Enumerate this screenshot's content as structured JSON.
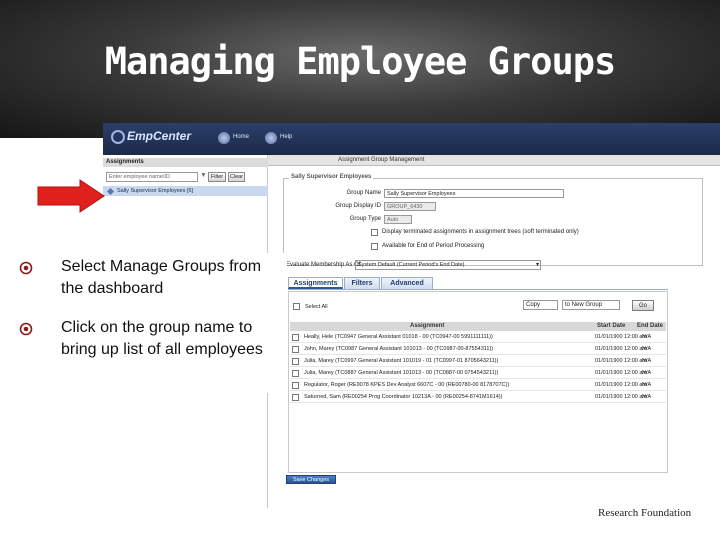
{
  "slide": {
    "title": "Managing Employee Groups",
    "bullets": [
      "Select Manage Groups from the dashboard",
      "Click on the group name  to bring up list of all employees"
    ],
    "footer_logo": "Research Foundation"
  },
  "app": {
    "brand": "EmpCenter",
    "nav": [
      "Home",
      "Help"
    ],
    "page_header": "Assignment Group Management",
    "left_pane": {
      "header": "Assignments",
      "search_placeholder": "Enter employee name/ID",
      "filter_button": "Filter",
      "clear_button": "Clear",
      "group_item": "Sally Supervisor Employees [6]"
    },
    "details": {
      "legend": "Sally Supervisor Employees",
      "group_name_label": "Group Name",
      "group_name_value": "Sally Supervisor Employees",
      "display_id_label": "Group Display ID",
      "display_id_value": "GROUP_6430",
      "group_type_label": "Group Type",
      "group_type_value": "Auto",
      "option1": "Display terminated assignments in assignment trees (soft terminated only)",
      "option2": "Available for End of Period Processing",
      "evaluate_label": "Evaluate Membership As Of",
      "evaluate_value": "System Default (Current Period's End Date)"
    },
    "tabs": [
      "Assignments",
      "Filters",
      "Advanced"
    ],
    "grid": {
      "select_all": "Select All",
      "copy_option": "Copy",
      "target_option": "to New Group",
      "go_button": "Go",
      "columns": [
        "Assignment",
        "Start Date",
        "End Date"
      ],
      "rows": [
        {
          "assignment": "Heally, Hele (TC0947 General Assistant 01018 - 00 (TC0947-00 5991111111))",
          "start": "01/01/1900 12:00 am",
          "end": "N/A"
        },
        {
          "assignment": "John, Marey (TC0987 General Assistant 101013 - 00 (TC0987-00-87554311))",
          "start": "01/01/1900 12:00 am",
          "end": "N/A"
        },
        {
          "assignment": "Julia, Marey (TC0997 General Assistant 101019 - 01 (TC0997-01 8705643211))",
          "start": "01/01/1900 12:00 am",
          "end": "N/A"
        },
        {
          "assignment": "Julia, Marey (TC0887 General Assistant 101013 - 00 (TC0887-00 0754543211))",
          "start": "01/01/1900 12:00 am",
          "end": "N/A"
        },
        {
          "assignment": "Regulator, Roger (RE9078 KPES Dev Analyst 6607C - 00 (RE00780-00 8178707C))",
          "start": "01/01/1900 12:00 am",
          "end": "N/A"
        },
        {
          "assignment": "Saturned, Sam (RE00254 Prog Coordinator 10213A - 00 (RE00254-8741M1614))",
          "start": "01/01/1900 12:00 am",
          "end": "N/A"
        }
      ]
    },
    "save_button": "Save Changes"
  },
  "colors": {
    "header_dark": "#161616",
    "app_navy": "#1c2a48",
    "arrow_red": "#e0201c",
    "accent_blue": "#2c5aa0"
  }
}
